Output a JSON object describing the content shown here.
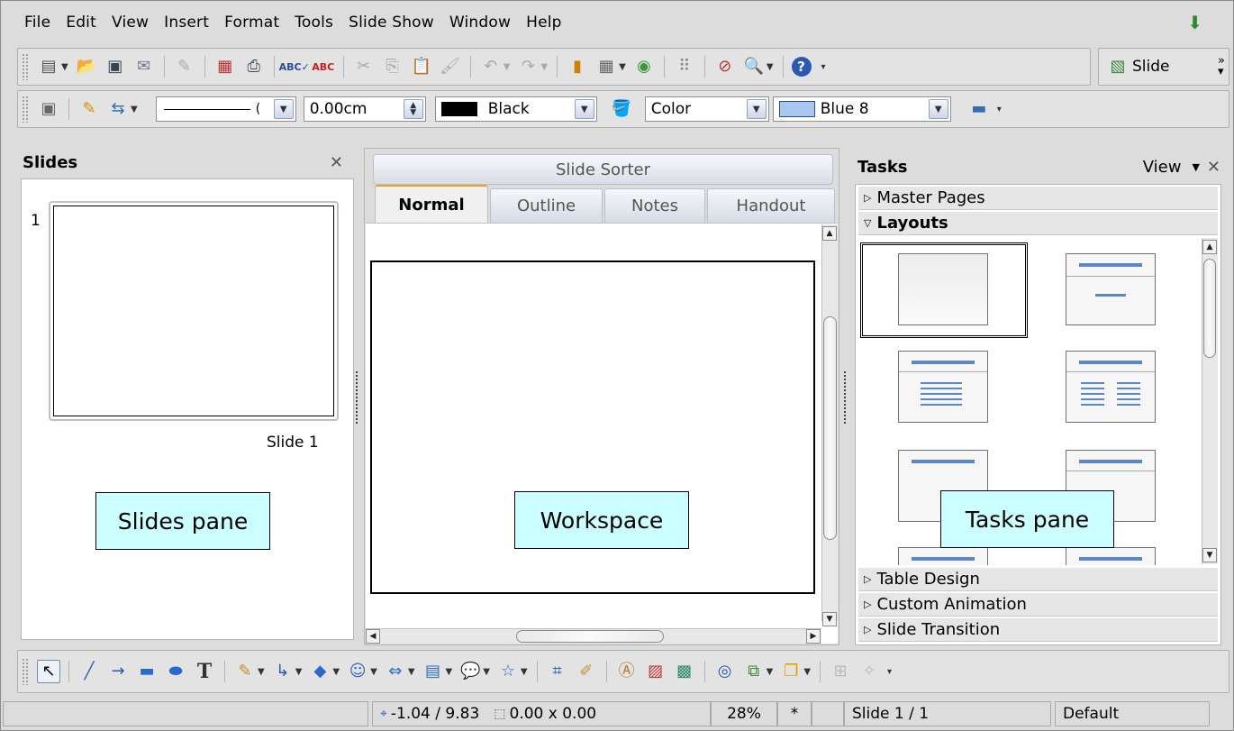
{
  "menu": [
    "File",
    "Edit",
    "View",
    "Insert",
    "Format",
    "Tools",
    "Slide Show",
    "Window",
    "Help"
  ],
  "toolbar": {
    "slide_button_label": "Slide",
    "line_width": "0.00cm",
    "line_color": "Black",
    "area_style": "Color",
    "area_color": "Blue 8",
    "line_color_hex": "#000000",
    "area_color_hex": "#a8c8f0"
  },
  "slides_pane": {
    "title": "Slides",
    "slide_number": "1",
    "slide_label": "Slide 1",
    "callout": "Slides pane"
  },
  "workspace": {
    "sorter_tab": "Slide Sorter",
    "tabs": [
      "Normal",
      "Outline",
      "Notes",
      "Handout"
    ],
    "active_tab": "Normal",
    "callout": "Workspace"
  },
  "tasks_pane": {
    "title": "Tasks",
    "view_label": "View",
    "sections_top": [
      "Master Pages",
      "Layouts"
    ],
    "sections_bottom": [
      "Table Design",
      "Custom Animation",
      "Slide Transition"
    ],
    "callout": "Tasks pane"
  },
  "statusbar": {
    "position": "-1.04 / 9.83",
    "size": "0.00 x 0.00",
    "zoom": "28%",
    "modified": "*",
    "slide": "Slide 1 / 1",
    "master": "Default"
  },
  "colors": {
    "callout_bg": "#ccffff",
    "accent_tab": "#f0a020",
    "layout_bar": "#5d86c6"
  }
}
